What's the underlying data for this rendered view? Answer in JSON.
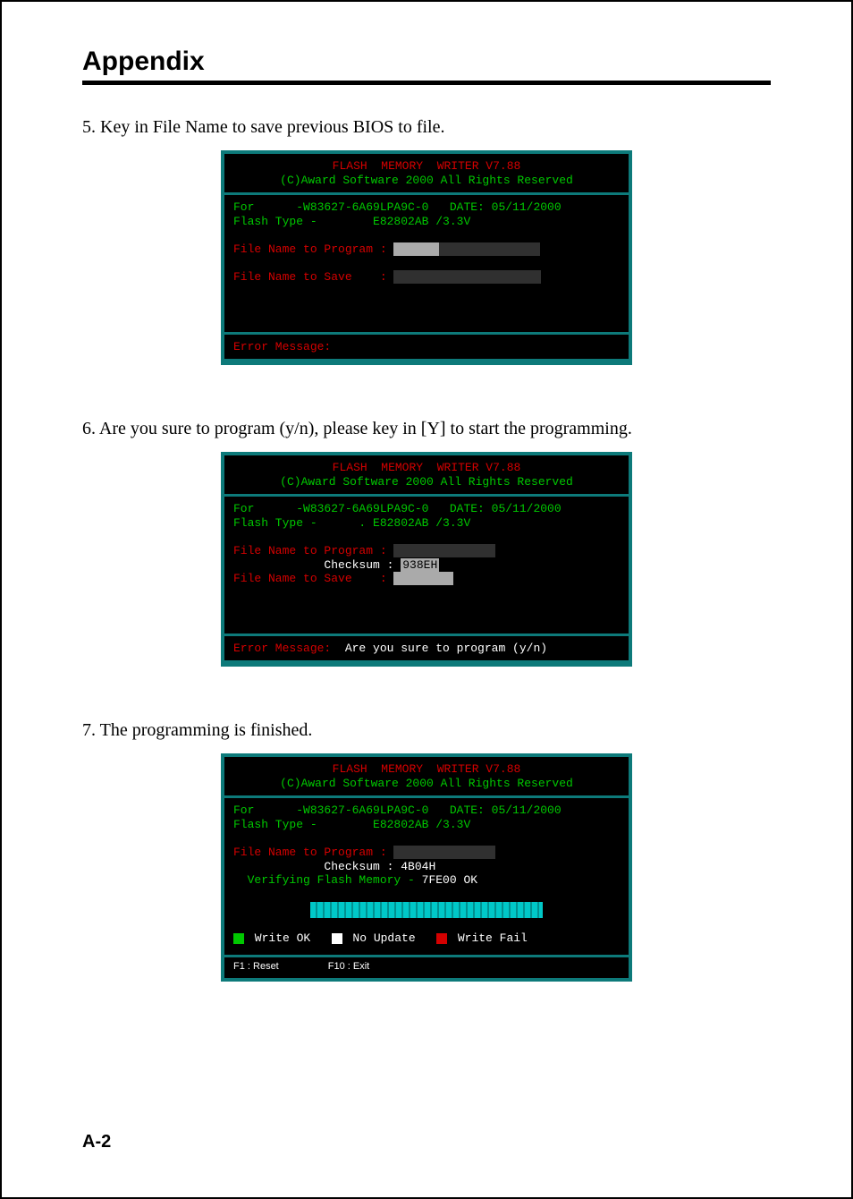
{
  "page": {
    "title": "Appendix",
    "number": "A-2"
  },
  "step5": {
    "text": "5. Key in File Name to save previous BIOS to file.",
    "term": {
      "header_line1": "FLASH  MEMORY  WRITER V7.88",
      "header_line2": "(C)Award Software 2000 All Rights Reserved",
      "body_for": "For      -W83627-6A69LPA9C-0   DATE: 05/11/2000",
      "body_flash": "Flash Type -        E82802AB /3.3V",
      "prog_label": "File Name to Program :",
      "prog_value": "      ",
      "save_label": "File Name to Save    :",
      "save_value": " ",
      "err_label": "Error Message:",
      "err_value": ""
    }
  },
  "step6": {
    "text": "6. Are you sure to program (y/n), please key in [Y] to start the programming.",
    "term": {
      "header_line1": "FLASH  MEMORY  WRITER V7.88",
      "header_line2": "(C)Award Software 2000 All Rights Reserved",
      "body_for": "For      -W83627-6A69LPA9C-0   DATE: 05/11/2000",
      "body_flash": "Flash Type -      . E82802AB /3.3V",
      "prog_label": "File Name to Program :",
      "prog_value": "              ",
      "checksum_label": "             Checksum :",
      "checksum_value": "938EH",
      "save_label": "File Name to Save    :",
      "save_value": "        ",
      "err_label": "Error Message:",
      "err_value": "  Are you sure to program (y/n)"
    }
  },
  "step7": {
    "text": "7. The programming is finished.",
    "term": {
      "header_line1": "FLASH  MEMORY  WRITER V7.88",
      "header_line2": "(C)Award Software 2000 All Rights Reserved",
      "body_for": "For      -W83627-6A69LPA9C-0   DATE: 05/11/2000",
      "body_flash": "Flash Type -        E82802AB /3.3V",
      "prog_label": "File Name to Program :",
      "prog_value": "              ",
      "checksum_label": "             Checksum :",
      "checksum_value": " 4B04H",
      "verify_label": "  Verifying Flash Memory - ",
      "verify_value": "7FE00 OK",
      "legend_write_ok": " Write OK",
      "legend_no_update": " No Update",
      "legend_write_fail": " Write Fail",
      "fkey_left": "F1 : Reset",
      "fkey_right": "F10 : Exit"
    }
  }
}
